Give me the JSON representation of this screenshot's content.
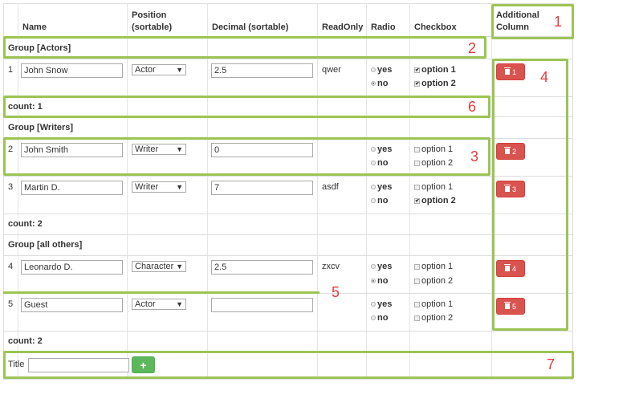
{
  "headers": {
    "name": "Name",
    "position_line1": "Position",
    "position_line2": "(sortable)",
    "decimal": "Decimal (sortable)",
    "readonly": "ReadOnly",
    "radio": "Radio",
    "checkbox": "Checkbox",
    "additional_line1": "Additional",
    "additional_line2": "Column"
  },
  "groups": [
    {
      "title": "Group [Actors]",
      "count": "count: 1"
    },
    {
      "title": "Group [Writers]",
      "count": "count: 2"
    },
    {
      "title": "Group [all others]",
      "count": "count: 2"
    }
  ],
  "rows": [
    {
      "index": "1",
      "name": "John Snow",
      "position": "Actor",
      "decimal": "2.5",
      "readonly": "qwer",
      "radio": "no",
      "option1": true,
      "option2": true,
      "delete_label": "1"
    },
    {
      "index": "2",
      "name": "John Smith",
      "position": "Writer",
      "decimal": "0",
      "readonly": "",
      "radio": "none",
      "option1": false,
      "option2": false,
      "delete_label": "2"
    },
    {
      "index": "3",
      "name": "Martin D.",
      "position": "Writer",
      "decimal": "7",
      "readonly": "asdf",
      "radio": "none",
      "option1": false,
      "option2": true,
      "delete_label": "3"
    },
    {
      "index": "4",
      "name": "Leonardo D.",
      "position": "Character",
      "decimal": "2.5",
      "readonly": "zxcv",
      "radio": "no",
      "option1": false,
      "option2": false,
      "delete_label": "4"
    },
    {
      "index": "5",
      "name": "Guest",
      "position": "Actor",
      "decimal": "",
      "readonly": "",
      "radio": "none",
      "option1": false,
      "option2": false,
      "delete_label": "5"
    }
  ],
  "radio_labels": {
    "yes": "yes",
    "no": "no"
  },
  "checkbox_labels": {
    "option1": "option 1",
    "option2": "option 2"
  },
  "footer": {
    "title_label": "Title",
    "title_value": "",
    "add_label": "+"
  },
  "annotations": [
    "1",
    "2",
    "3",
    "4",
    "5",
    "6",
    "7"
  ],
  "colors": {
    "annotation": "#9cc454",
    "annotation_number": "#e23b3b",
    "delete": "#d9534f",
    "add": "#5cb85c"
  }
}
